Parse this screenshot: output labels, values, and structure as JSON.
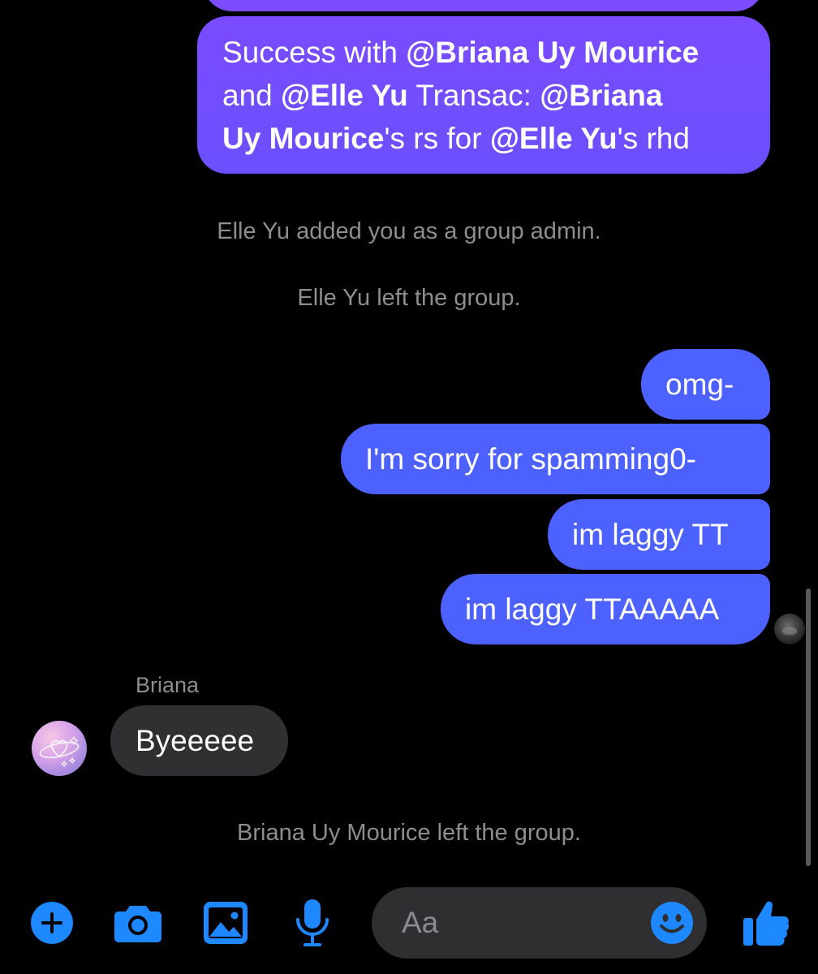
{
  "colors": {
    "background": "#000000",
    "sent_bubble": "#4d61ff",
    "sent_bubble_purple": "#7a4cfe",
    "received_bubble": "#303032",
    "system_text": "#8d8d92",
    "accent": "#1d88ff",
    "composer_bg": "#2f2f31"
  },
  "thread": {
    "big_message": {
      "line1_a": "Success with ",
      "line1_b": "@Briana Uy Mourice",
      "line2_a": "and ",
      "line2_b": "@Elle Yu",
      "line2_c": " Transac: ",
      "line2_d": "@Briana",
      "line3_a": "Uy Mourice",
      "line3_b": "'s rs for ",
      "line3_c": "@Elle Yu",
      "line3_d": "'s rhd"
    },
    "system_1": "Elle Yu added you as a group admin.",
    "system_2": "Elle Yu left the group.",
    "sent": [
      "omg-",
      "I'm sorry for spamming0-",
      "im laggy TT",
      "im laggy TTAAAAA"
    ],
    "received_sender": "Briana",
    "received_message": "Byeeeee",
    "system_3": "Briana Uy Mourice left the group."
  },
  "composer": {
    "placeholder": "Aa",
    "icons": [
      "plus-icon",
      "camera-icon",
      "gallery-icon",
      "microphone-icon",
      "emoji-icon",
      "thumbs-up-icon"
    ]
  }
}
